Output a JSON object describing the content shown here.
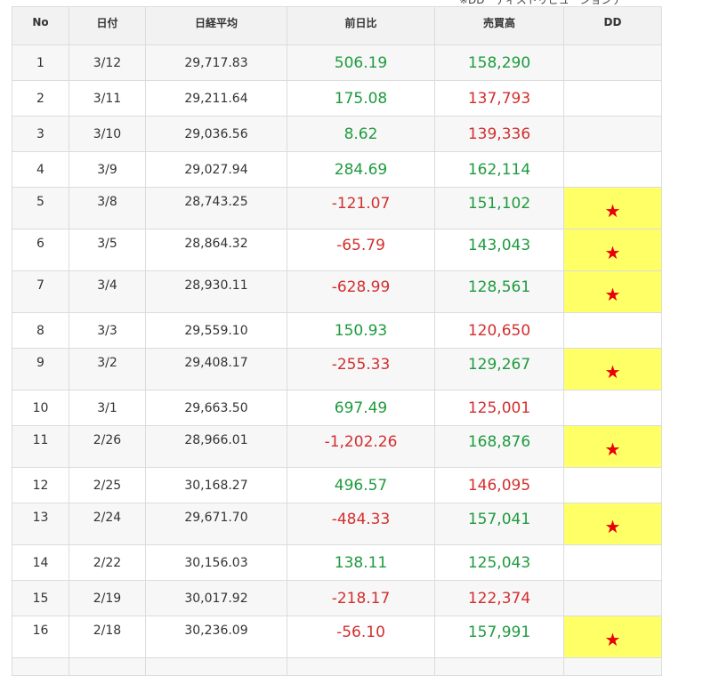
{
  "top_note": "※DD　ディストリビューションデー",
  "headers": {
    "no": "No",
    "date": "日付",
    "average": "日経平均",
    "change": "前日比",
    "volume": "売買高",
    "dd": "DD"
  },
  "colors": {
    "positive": "#1e9b3e",
    "negative": "#d32f2f",
    "dd_highlight": "#ffff66",
    "star": "#e8000b"
  },
  "star_glyph": "★",
  "rows": [
    {
      "no": "1",
      "date": "3/12",
      "average": "29,717.83",
      "change": "506.19",
      "change_sign": "pos",
      "volume": "158,290",
      "volume_sign": "pos",
      "dd": false
    },
    {
      "no": "2",
      "date": "3/11",
      "average": "29,211.64",
      "change": "175.08",
      "change_sign": "pos",
      "volume": "137,793",
      "volume_sign": "neg",
      "dd": false
    },
    {
      "no": "3",
      "date": "3/10",
      "average": "29,036.56",
      "change": "8.62",
      "change_sign": "pos",
      "volume": "139,336",
      "volume_sign": "neg",
      "dd": false
    },
    {
      "no": "4",
      "date": "3/9",
      "average": "29,027.94",
      "change": "284.69",
      "change_sign": "pos",
      "volume": "162,114",
      "volume_sign": "pos",
      "dd": false
    },
    {
      "no": "5",
      "date": "3/8",
      "average": "28,743.25",
      "change": "-121.07",
      "change_sign": "neg",
      "volume": "151,102",
      "volume_sign": "pos",
      "dd": true
    },
    {
      "no": "6",
      "date": "3/5",
      "average": "28,864.32",
      "change": "-65.79",
      "change_sign": "neg",
      "volume": "143,043",
      "volume_sign": "pos",
      "dd": true
    },
    {
      "no": "7",
      "date": "3/4",
      "average": "28,930.11",
      "change": "-628.99",
      "change_sign": "neg",
      "volume": "128,561",
      "volume_sign": "pos",
      "dd": true
    },
    {
      "no": "8",
      "date": "3/3",
      "average": "29,559.10",
      "change": "150.93",
      "change_sign": "pos",
      "volume": "120,650",
      "volume_sign": "neg",
      "dd": false
    },
    {
      "no": "9",
      "date": "3/2",
      "average": "29,408.17",
      "change": "-255.33",
      "change_sign": "neg",
      "volume": "129,267",
      "volume_sign": "pos",
      "dd": true
    },
    {
      "no": "10",
      "date": "3/1",
      "average": "29,663.50",
      "change": "697.49",
      "change_sign": "pos",
      "volume": "125,001",
      "volume_sign": "neg",
      "dd": false
    },
    {
      "no": "11",
      "date": "2/26",
      "average": "28,966.01",
      "change": "-1,202.26",
      "change_sign": "neg",
      "volume": "168,876",
      "volume_sign": "pos",
      "dd": true
    },
    {
      "no": "12",
      "date": "2/25",
      "average": "30,168.27",
      "change": "496.57",
      "change_sign": "pos",
      "volume": "146,095",
      "volume_sign": "neg",
      "dd": false
    },
    {
      "no": "13",
      "date": "2/24",
      "average": "29,671.70",
      "change": "-484.33",
      "change_sign": "neg",
      "volume": "157,041",
      "volume_sign": "pos",
      "dd": true
    },
    {
      "no": "14",
      "date": "2/22",
      "average": "30,156.03",
      "change": "138.11",
      "change_sign": "pos",
      "volume": "125,043",
      "volume_sign": "pos",
      "dd": false
    },
    {
      "no": "15",
      "date": "2/19",
      "average": "30,017.92",
      "change": "-218.17",
      "change_sign": "neg",
      "volume": "122,374",
      "volume_sign": "neg",
      "dd": false
    },
    {
      "no": "16",
      "date": "2/18",
      "average": "30,236.09",
      "change": "-56.10",
      "change_sign": "neg",
      "volume": "157,991",
      "volume_sign": "pos",
      "dd": true
    }
  ]
}
